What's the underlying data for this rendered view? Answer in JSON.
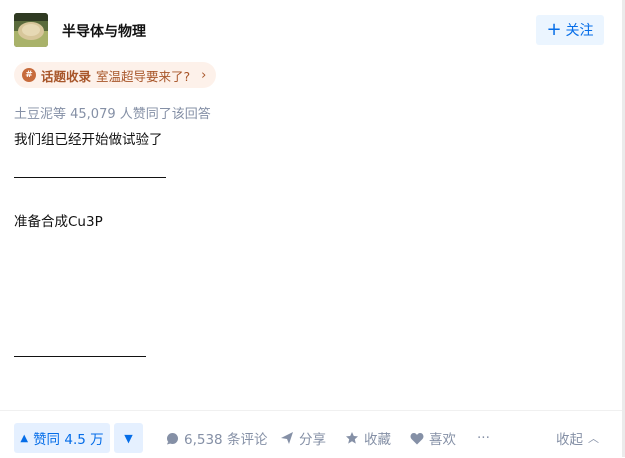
{
  "author": {
    "name": "半导体与物理"
  },
  "follow_button": {
    "label": "关注"
  },
  "topic": {
    "tag": "话题收录",
    "title": "室温超导要来了?"
  },
  "voters_text": "土豆泥等 45,079 人赞同了该回答",
  "answer": {
    "lines": [
      "我们组已经开始做试验了",
      "准备合成Cu3P"
    ]
  },
  "actions": {
    "vote_up_label": "赞同 4.5 万",
    "comments_label": "6,538 条评论",
    "share_label": "分享",
    "collect_label": "收藏",
    "like_label": "喜欢",
    "more_label": "···",
    "collapse_label": "收起"
  },
  "colors": {
    "accent": "#056de8",
    "topic": "#a8562a",
    "muted": "#8590a6"
  }
}
